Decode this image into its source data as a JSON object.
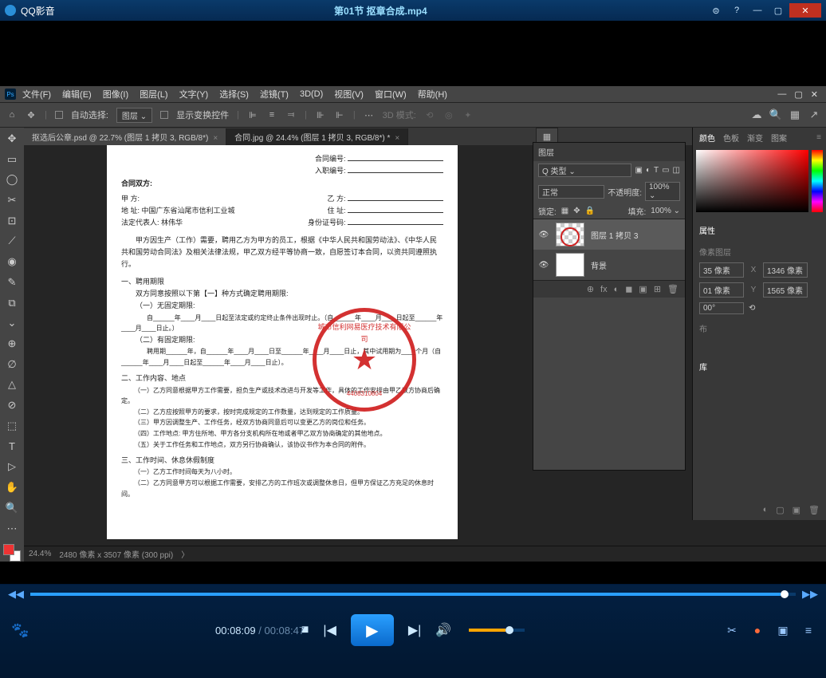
{
  "player": {
    "app_name": "QQ影音",
    "video_title": "第01节 抠章合成.mp4",
    "time_current": "00:08:09",
    "time_total": "00:08:47",
    "win_btns": {
      "chat": "⊜",
      "help": "?",
      "min": "—",
      "max": "▢",
      "close": "✕"
    },
    "seek_btns": {
      "prev": "◀◀",
      "next": "▶▶"
    },
    "ctrl": {
      "stop": "■",
      "prev": "|◀",
      "play": "▶",
      "next": "▶|",
      "vol": "🔊"
    },
    "right_btns": {
      "tool": "✂",
      "rec": "●",
      "screen": "▣",
      "list": "≡"
    },
    "left_btn": "🐾"
  },
  "ps": {
    "badge": "Ps",
    "menu": [
      "文件(F)",
      "编辑(E)",
      "图像(I)",
      "图层(L)",
      "文字(Y)",
      "选择(S)",
      "滤镜(T)",
      "3D(D)",
      "视图(V)",
      "窗口(W)",
      "帮助(H)"
    ],
    "menu_right": [
      "—",
      "▢",
      "✕"
    ],
    "options": {
      "autosel_label": "自动选择:",
      "layer_sel": "图层 ⌄",
      "transform_label": "显示变换控件",
      "mode3d_label": "3D 模式:"
    },
    "tabs": [
      {
        "label": "抠选后公章.psd @ 22.7% (图层 1 拷贝 3, RGB/8*)"
      },
      {
        "label": "合同.jpg @ 24.4% (图层 1 拷贝 3, RGB/8*) *"
      }
    ],
    "tools_glyphs": [
      "✥",
      "▭",
      "◯",
      "✂",
      "⊡",
      "⟋",
      "◉",
      "✎",
      "⧉",
      "⌄",
      "⊕",
      "∅",
      "△",
      "⊘",
      "⬚",
      "T",
      "▷",
      "✋",
      "🔍",
      "⋯"
    ],
    "status": {
      "zoom": "24.4%",
      "dims": "2480 像素 x 3507 像素 (300 ppi)"
    },
    "panel_tabs_top": {
      "color": "颜色",
      "swatch": "色板",
      "grad": "渐变",
      "pat": "图案"
    },
    "panel_layers_title": "图层",
    "layers_filter": {
      "kind": "Q 类型 ⌄"
    },
    "blend": {
      "mode": "正常",
      "opacity_label": "不透明度:",
      "opacity_val": "100% ⌄"
    },
    "lock": {
      "label": "锁定:",
      "fill_label": "填充:",
      "fill_val": "100% ⌄"
    },
    "layer_items": [
      {
        "name": "图层 1 拷贝 3"
      },
      {
        "name": "背景"
      }
    ],
    "props_title": "属性",
    "props_sub": "像素图层",
    "props": {
      "w_lbl": "W",
      "w_val": "35 像素",
      "x_lbl": "X",
      "x_val": "1346 像素",
      "h_lbl": "H",
      "h_val": "01 像素",
      "y_lbl": "Y",
      "y_val": "1565 像素",
      "angle": "00°",
      "flip": "⟲"
    },
    "dist_label": "布",
    "lib_label": "库",
    "foot_icons": [
      "⊕",
      "fx",
      "◐",
      "◼",
      "▣",
      "⊞",
      "🗑"
    ]
  },
  "doc": {
    "h1": "合同编号:",
    "h2": "入职编号:",
    "parties": "合同双方:",
    "jia": "甲 方:",
    "yi": "乙 方:",
    "addr": "地 址: 中国广东省汕尾市信利工业城",
    "addr2": "住 址:",
    "rep": "法定代表人: 林伟华",
    "id": "身份证号码:",
    "p1": "甲方因生产（工作）需要，聘用乙方为甲方的员工，根据《中华人民共和国劳动法》、《中华人民共和国劳动合同法》及相关法律法规，甲乙双方经平等协商一致，自愿签订本合同，以资共同遵照执行。",
    "s1": "一、聘用期限",
    "s1a": "双方同意按照以下第【一】种方式确定聘用期限:",
    "s1b": "（一）无固定期限:",
    "s1b2": "自______年____月____日起至法定或约定终止条件出现时止。（自______年____月____日起至______年____月____日止。）",
    "s1c": "（二）有固定期限:",
    "s1c2": "聘用期______年，自______年____月____日至______年____月____日止，其中试用期为____个月（自______年____月____日起至______年____月____日止）。",
    "s2": "二、工作内容、地点",
    "s2a": "（一）乙方同意根据甲方工作需要，担负生产或技术改进与开发等工作，具体的工作安排由甲乙双方协商后确定。",
    "s2b": "（二）乙方应按照甲方的要求，按时完成规定的工作数量，达到规定的工作质量。",
    "s2c": "（三）甲方因调整生产、工作任务，经双方协商同意后可以变更乙方的岗位和任务。",
    "s2d": "（四）工作地点: 甲方住所地、甲方各分支机构所在地或者甲乙双方协商确定的其他地点。",
    "s2e": "（五）关于工作任务和工作地点，双方另行协商确认，该协议书作为本合同的附件。",
    "s3": "三、工作时间、休息休假制度",
    "s3a": "（一）乙方工作时间每天为八小时。",
    "s3b": "（二）乙方同意甲方可以根据工作需要，安排乙方的工作班次或调整休息日，但甲方保证乙方充足的休息时间。",
    "stamp_text": "城市信利网易医疗技术有限公司",
    "stamp_num": "4408310804"
  }
}
